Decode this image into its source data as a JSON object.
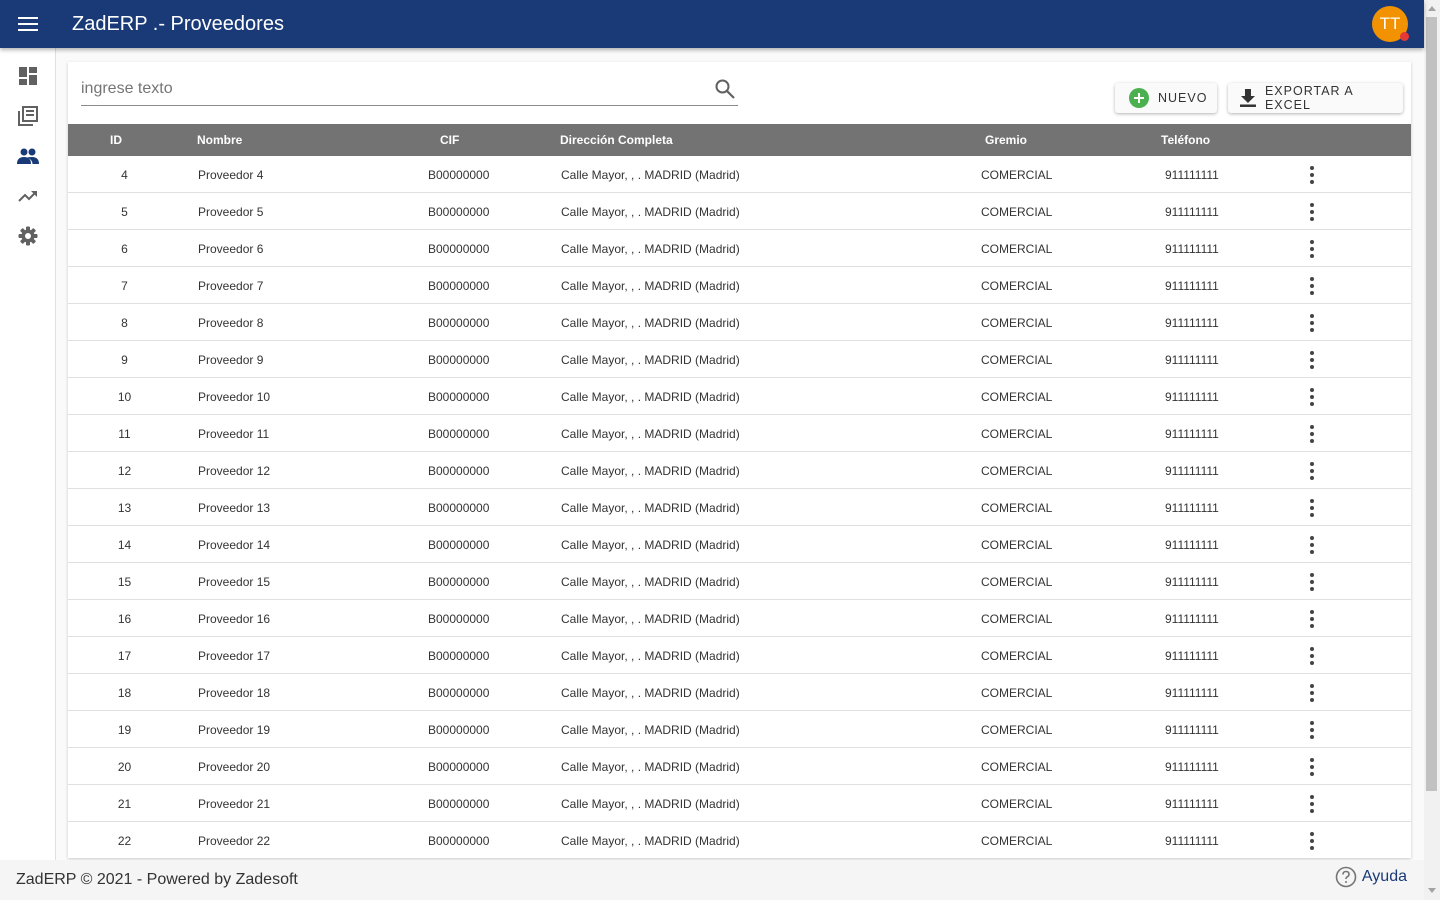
{
  "app": {
    "title": "ZadERP .- Proveedores",
    "avatar_initials": "TT"
  },
  "colors": {
    "topbar": "#193a77",
    "avatar": "#f39200",
    "table_header": "#737373",
    "add_icon": "#4caf50"
  },
  "sidebar": {
    "items": [
      {
        "icon": "dashboard-icon"
      },
      {
        "icon": "library-books-icon"
      },
      {
        "icon": "people-icon",
        "active": true
      },
      {
        "icon": "trending-up-icon"
      },
      {
        "icon": "settings-gear-icon"
      }
    ]
  },
  "search": {
    "placeholder": "ingrese texto",
    "value": ""
  },
  "toolbar": {
    "new_label": "NUEVO",
    "export_label": "EXPORTAR A EXCEL"
  },
  "table": {
    "columns": [
      "ID",
      "Nombre",
      "CIF",
      "Dirección Completa",
      "Gremio",
      "Teléfono"
    ],
    "rows": [
      {
        "id": "4",
        "nombre": "Proveedor 4",
        "cif": "B00000000",
        "direccion": "Calle Mayor, , . MADRID (Madrid)",
        "gremio": "COMERCIAL",
        "telefono": "911111111"
      },
      {
        "id": "5",
        "nombre": "Proveedor 5",
        "cif": "B00000000",
        "direccion": "Calle Mayor, , . MADRID (Madrid)",
        "gremio": "COMERCIAL",
        "telefono": "911111111"
      },
      {
        "id": "6",
        "nombre": "Proveedor 6",
        "cif": "B00000000",
        "direccion": "Calle Mayor, , . MADRID (Madrid)",
        "gremio": "COMERCIAL",
        "telefono": "911111111"
      },
      {
        "id": "7",
        "nombre": "Proveedor 7",
        "cif": "B00000000",
        "direccion": "Calle Mayor, , . MADRID (Madrid)",
        "gremio": "COMERCIAL",
        "telefono": "911111111"
      },
      {
        "id": "8",
        "nombre": "Proveedor 8",
        "cif": "B00000000",
        "direccion": "Calle Mayor, , . MADRID (Madrid)",
        "gremio": "COMERCIAL",
        "telefono": "911111111"
      },
      {
        "id": "9",
        "nombre": "Proveedor 9",
        "cif": "B00000000",
        "direccion": "Calle Mayor, , . MADRID (Madrid)",
        "gremio": "COMERCIAL",
        "telefono": "911111111"
      },
      {
        "id": "10",
        "nombre": "Proveedor 10",
        "cif": "B00000000",
        "direccion": "Calle Mayor, , . MADRID (Madrid)",
        "gremio": "COMERCIAL",
        "telefono": "911111111"
      },
      {
        "id": "11",
        "nombre": "Proveedor 11",
        "cif": "B00000000",
        "direccion": "Calle Mayor, , . MADRID (Madrid)",
        "gremio": "COMERCIAL",
        "telefono": "911111111"
      },
      {
        "id": "12",
        "nombre": "Proveedor 12",
        "cif": "B00000000",
        "direccion": "Calle Mayor, , . MADRID (Madrid)",
        "gremio": "COMERCIAL",
        "telefono": "911111111"
      },
      {
        "id": "13",
        "nombre": "Proveedor 13",
        "cif": "B00000000",
        "direccion": "Calle Mayor, , . MADRID (Madrid)",
        "gremio": "COMERCIAL",
        "telefono": "911111111"
      },
      {
        "id": "14",
        "nombre": "Proveedor 14",
        "cif": "B00000000",
        "direccion": "Calle Mayor, , . MADRID (Madrid)",
        "gremio": "COMERCIAL",
        "telefono": "911111111"
      },
      {
        "id": "15",
        "nombre": "Proveedor 15",
        "cif": "B00000000",
        "direccion": "Calle Mayor, , . MADRID (Madrid)",
        "gremio": "COMERCIAL",
        "telefono": "911111111"
      },
      {
        "id": "16",
        "nombre": "Proveedor 16",
        "cif": "B00000000",
        "direccion": "Calle Mayor, , . MADRID (Madrid)",
        "gremio": "COMERCIAL",
        "telefono": "911111111"
      },
      {
        "id": "17",
        "nombre": "Proveedor 17",
        "cif": "B00000000",
        "direccion": "Calle Mayor, , . MADRID (Madrid)",
        "gremio": "COMERCIAL",
        "telefono": "911111111"
      },
      {
        "id": "18",
        "nombre": "Proveedor 18",
        "cif": "B00000000",
        "direccion": "Calle Mayor, , . MADRID (Madrid)",
        "gremio": "COMERCIAL",
        "telefono": "911111111"
      },
      {
        "id": "19",
        "nombre": "Proveedor 19",
        "cif": "B00000000",
        "direccion": "Calle Mayor, , . MADRID (Madrid)",
        "gremio": "COMERCIAL",
        "telefono": "911111111"
      },
      {
        "id": "20",
        "nombre": "Proveedor 20",
        "cif": "B00000000",
        "direccion": "Calle Mayor, , . MADRID (Madrid)",
        "gremio": "COMERCIAL",
        "telefono": "911111111"
      },
      {
        "id": "21",
        "nombre": "Proveedor 21",
        "cif": "B00000000",
        "direccion": "Calle Mayor, , . MADRID (Madrid)",
        "gremio": "COMERCIAL",
        "telefono": "911111111"
      },
      {
        "id": "22",
        "nombre": "Proveedor 22",
        "cif": "B00000000",
        "direccion": "Calle Mayor, , . MADRID (Madrid)",
        "gremio": "COMERCIAL",
        "telefono": "911111111"
      }
    ]
  },
  "footer": {
    "text": "ZadERP © 2021 - Powered by Zadesoft",
    "help_label": "Ayuda"
  }
}
